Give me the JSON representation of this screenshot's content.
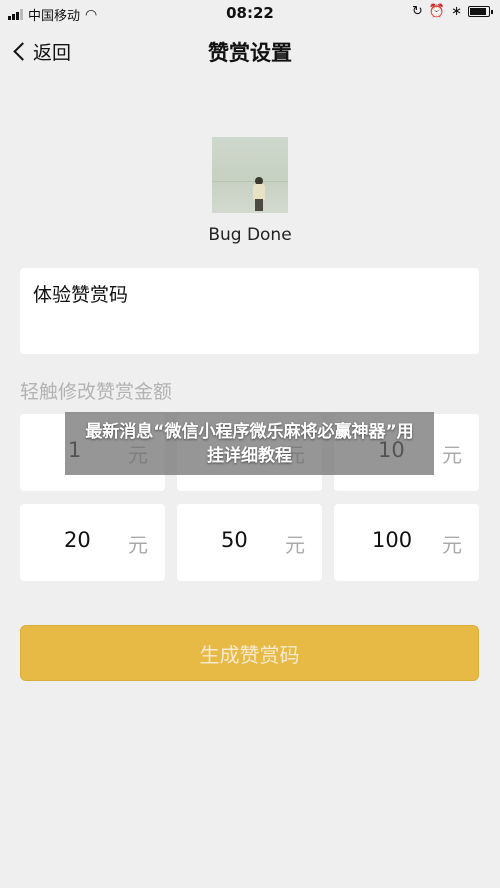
{
  "status_bar": {
    "carrier": "中国移动",
    "time": "08:22",
    "battery_level": 0.95,
    "icons": [
      "signal-icon",
      "wifi-icon",
      "rotation-lock-icon",
      "alarm-icon",
      "bluetooth-icon",
      "battery-icon"
    ]
  },
  "nav": {
    "back_label": "返回",
    "title": "赞赏设置"
  },
  "profile": {
    "name": "Bug Done"
  },
  "code_name": {
    "value": "体验赞赏码"
  },
  "amount_section": {
    "label": "轻触修改赞赏金额",
    "unit": "元",
    "amounts": [
      "1",
      "",
      "10",
      "20",
      "50",
      "100"
    ]
  },
  "generate_button": {
    "label": "生成赞赏码"
  },
  "overlay": {
    "text": "最新消息“微信小程序微乐麻将必赢神器”用挂详细教程"
  },
  "colors": {
    "background": "#efeff0",
    "accent": "#e6ba45",
    "muted_text": "#b3b3b3"
  }
}
